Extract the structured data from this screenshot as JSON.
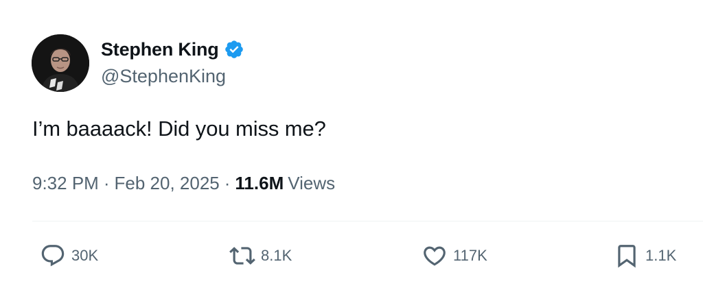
{
  "author": {
    "display_name": "Stephen King",
    "handle": "@StephenKing",
    "verified": true,
    "verified_color": "#1d9bf0"
  },
  "tweet": {
    "text": "I’m baaaack! Did you miss me?",
    "time": "9:32 PM",
    "date": "Feb 20, 2025",
    "separator": "·",
    "views_count": "11.6M",
    "views_label": "Views"
  },
  "actions": {
    "reply": {
      "icon": "reply-icon",
      "count": "30K"
    },
    "repost": {
      "icon": "repost-icon",
      "count": "8.1K"
    },
    "like": {
      "icon": "heart-icon",
      "count": "117K"
    },
    "bookmark": {
      "icon": "bookmark-icon",
      "count": "1.1K"
    }
  },
  "colors": {
    "text_primary": "#0f1419",
    "text_secondary": "#536471",
    "divider": "#eff3f4"
  }
}
